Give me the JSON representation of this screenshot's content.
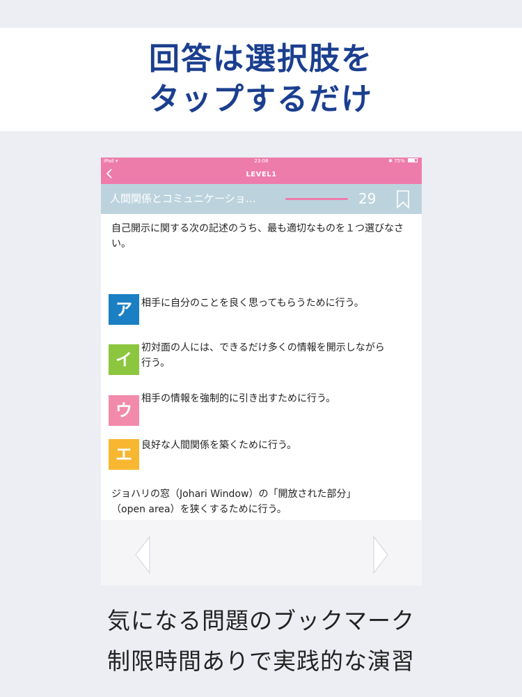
{
  "headline": {
    "line1": "回答は選択肢を",
    "line2": "タップするだけ"
  },
  "status_bar": {
    "carrier": "iPad",
    "time": "23:08",
    "battery": "75%"
  },
  "nav": {
    "back_icon": "chevron-left-icon",
    "title": "LEVEL1"
  },
  "category": {
    "title": "人間関係とコミュニケーショ…",
    "question_count": "29",
    "bookmark_icon": "bookmark-icon",
    "timer_color": "#ee7cab"
  },
  "question": {
    "text": "自己開示に関する次の記述のうち、最も適切なものを１つ選びなさい。"
  },
  "choices": [
    {
      "label": "ア",
      "text": "相手に自分のことを良く思ってもらうために行う。",
      "color": "#1a7fc3"
    },
    {
      "label": "イ",
      "text": "初対面の人には、できるだけ多くの情報を開示しながら行う。",
      "color": "#8cc63f"
    },
    {
      "label": "ウ",
      "text": "相手の情報を強制的に引き出すために行う。",
      "color": "#f28bab"
    },
    {
      "label": "エ",
      "text": "良好な人間関係を築くために行う。",
      "color": "#f7b731"
    }
  ],
  "explanation": {
    "line1": "ジョハリの窓（Johari Window）の「開放された部分」",
    "line2": "（open area）を狭くするために行う。"
  },
  "bottom_nav": {
    "prev_icon": "arrow-left-icon",
    "next_icon": "arrow-right-icon"
  },
  "footer": {
    "line1": "気になる問題のブックマーク",
    "line2": "制限時間ありで実践的な演習"
  },
  "colors": {
    "accent_pink": "#ee7cab",
    "headline_blue": "#1b3f8f",
    "category_bar": "#bcd3dd"
  }
}
